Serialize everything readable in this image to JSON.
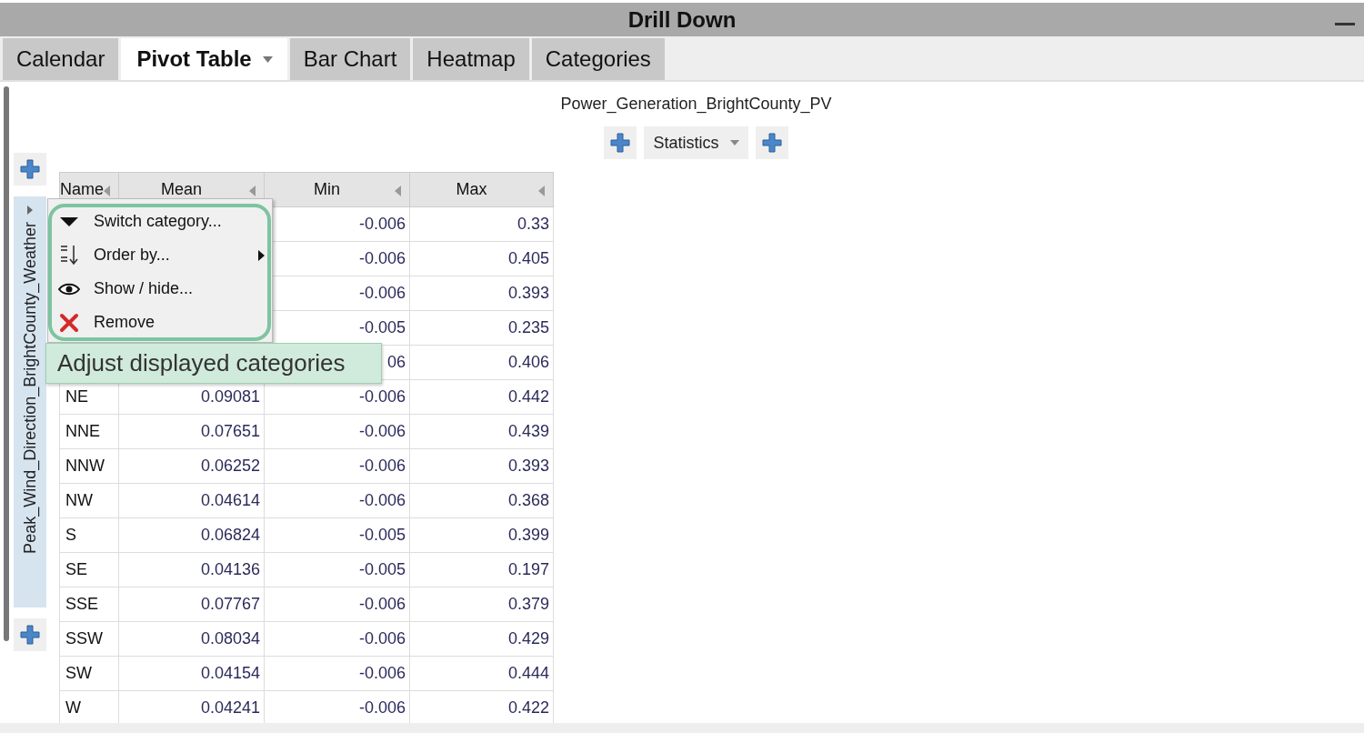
{
  "window": {
    "title": "Drill Down"
  },
  "tabs": [
    {
      "label": "Calendar",
      "selected": false,
      "has_menu": false
    },
    {
      "label": "Pivot Table",
      "selected": true,
      "has_menu": true
    },
    {
      "label": "Bar Chart",
      "selected": false,
      "has_menu": false
    },
    {
      "label": "Heatmap",
      "selected": false,
      "has_menu": false
    },
    {
      "label": "Categories",
      "selected": false,
      "has_menu": false
    }
  ],
  "column_field": {
    "label": "Power_Generation_BrightCounty_PV",
    "statistics_button": "Statistics"
  },
  "row_field": {
    "label": "Peak_Wind_Direction_BrightCounty_Weather"
  },
  "table": {
    "columns": [
      "Name",
      "Mean",
      "Min",
      "Max"
    ],
    "rows": [
      {
        "min": "-0.006",
        "max": "0.33"
      },
      {
        "min": "-0.006",
        "max": "0.405"
      },
      {
        "min": "-0.006",
        "max": "0.393"
      },
      {
        "min": "-0.005",
        "max": "0.235"
      },
      {
        "min": "06",
        "max": "0.406"
      },
      {
        "name": "NE",
        "mean": "0.09081",
        "min": "-0.006",
        "max": "0.442"
      },
      {
        "name": "NNE",
        "mean": "0.07651",
        "min": "-0.006",
        "max": "0.439"
      },
      {
        "name": "NNW",
        "mean": "0.06252",
        "min": "-0.006",
        "max": "0.393"
      },
      {
        "name": "NW",
        "mean": "0.04614",
        "min": "-0.006",
        "max": "0.368"
      },
      {
        "name": "S",
        "mean": "0.06824",
        "min": "-0.005",
        "max": "0.399"
      },
      {
        "name": "SE",
        "mean": "0.04136",
        "min": "-0.005",
        "max": "0.197"
      },
      {
        "name": "SSE",
        "mean": "0.07767",
        "min": "-0.006",
        "max": "0.379"
      },
      {
        "name": "SSW",
        "mean": "0.08034",
        "min": "-0.006",
        "max": "0.429"
      },
      {
        "name": "SW",
        "mean": "0.04154",
        "min": "-0.006",
        "max": "0.444"
      },
      {
        "name": "W",
        "mean": "0.04241",
        "min": "-0.006",
        "max": "0.422"
      }
    ]
  },
  "context_menu": {
    "items": [
      {
        "kind": "switch",
        "label": "Switch category...",
        "submenu": false
      },
      {
        "kind": "order",
        "label": "Order by...",
        "submenu": true
      },
      {
        "kind": "visibility",
        "label": "Show / hide...",
        "submenu": false
      },
      {
        "kind": "remove",
        "label": "Remove",
        "submenu": false
      }
    ]
  },
  "callout": {
    "text": "Adjust displayed categories"
  }
}
